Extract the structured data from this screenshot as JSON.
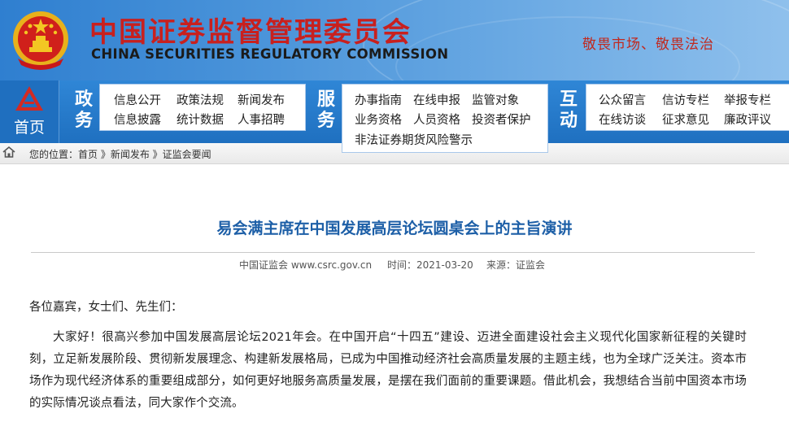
{
  "header": {
    "title_cn": "中国证券监督管理委员会",
    "title_en": "CHINA SECURITIES REGULATORY COMMISSION",
    "slogan": "敬畏市场、敬畏法治",
    "emblem_icon": "national-emblem-icon"
  },
  "nav": {
    "home_label": "首页",
    "groups": [
      {
        "category": "政务",
        "links": [
          "信息公开",
          "政策法规",
          "新闻发布",
          "信息披露",
          "统计数据",
          "人事招聘"
        ]
      },
      {
        "category": "服务",
        "links": [
          "办事指南",
          "在线申报",
          "监管对象",
          "业务资格",
          "人员资格",
          "投资者保护",
          "非法证券期货风险警示"
        ]
      },
      {
        "category": "互动",
        "links": [
          "公众留言",
          "信访专栏",
          "举报专栏",
          "在线访谈",
          "征求意见",
          "廉政评议"
        ]
      }
    ]
  },
  "breadcrumb": {
    "text": "您的位置：首页 》新闻发布 》证监会要闻"
  },
  "article": {
    "title": "易会满主席在中国发展高层论坛圆桌会上的主旨演讲",
    "source": "中国证监会 www.csrc.gov.cn",
    "date": "时间：2021-03-20",
    "origin": "来源：证监会",
    "greeting": "各位嘉宾，女士们、先生们：",
    "paragraph": "大家好！很高兴参加中国发展高层论坛2021年会。在中国开启“十四五”建设、迈进全面建设社会主义现代化国家新征程的关键时刻，立足新发展阶段、贯彻新发展理念、构建新发展格局，已成为中国推动经济社会高质量发展的主题主线，也为全球广泛关注。资本市场作为现代经济体系的重要组成部分，如何更好地服务高质量发展，是摆在我们面前的重要课题。借此机会，我想结合当前中国资本市场的实际情况谈点看法，同大家作个交流。"
  },
  "colors": {
    "brand_red": "#c8201e",
    "nav_blue": "#1f70c0",
    "title_blue": "#1d5fa7"
  }
}
